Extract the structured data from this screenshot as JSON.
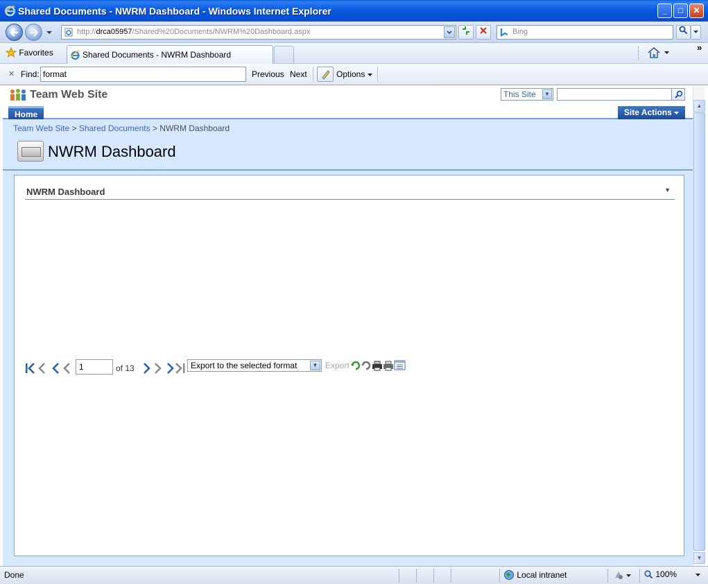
{
  "window": {
    "title": "Shared Documents - NWRM Dashboard - Windows Internet Explorer",
    "minimize_glyph": "_",
    "maximize_glyph": "□",
    "close_glyph": "✕"
  },
  "address_bar": {
    "url_prefix": "http://",
    "url_host": "drca05957",
    "url_path": "/Shared%20Documents/NWRM%20Dashboard.aspx",
    "search_placeholder": "Bing"
  },
  "favorites_bar": {
    "favorites_label": "Favorites",
    "tab_title": "Shared Documents - NWRM Dashboard",
    "chevron": "»"
  },
  "find_bar": {
    "close_glyph": "✕",
    "find_label": "Find:",
    "find_value": "format",
    "previous_label": "Previous",
    "next_label": "Next",
    "options_label": "Options"
  },
  "sharepoint": {
    "site_title": "Team Web Site",
    "scope": "This Site",
    "home_tab": "Home",
    "site_actions": "Site Actions",
    "breadcrumb": [
      "Team Web Site",
      "Shared Documents",
      "NWRM Dashboard"
    ],
    "breadcrumb_sep": ">",
    "page_title": "NWRM Dashboard",
    "webpart_title": "NWRM Dashboard"
  },
  "report_toolbar": {
    "current_page": "1",
    "of_total": "of 13",
    "export_format": "Export to the selected format",
    "export_label": "Export"
  },
  "status_bar": {
    "status_text": "Done",
    "zone": "Local intranet",
    "zoom": "100%"
  },
  "colors": {
    "ie_titlebar": "#0a5adf",
    "sp_blue": "#21509a",
    "title_area_bg": "#d6e8ff",
    "link_blue": "#3966bf"
  }
}
